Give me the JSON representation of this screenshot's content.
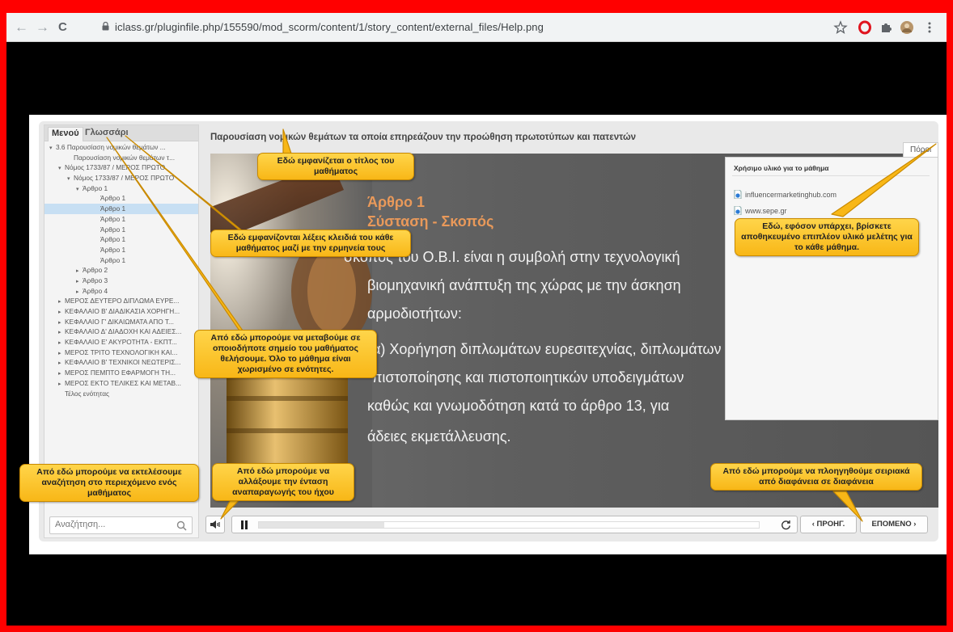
{
  "browser": {
    "url": "iclass.gr/pluginfile.php/155590/mod_scorm/content/1/story_content/external_files/Help.png",
    "back": "←",
    "forward": "→",
    "reload": "C"
  },
  "sidebar": {
    "tabs": [
      "Μενού",
      "Γλωσσάρι"
    ],
    "toc": [
      {
        "label": "3.6 Παρουσίαση νομικών θεμάτων ...",
        "indent": 0,
        "arrow": "▾"
      },
      {
        "label": "Παρουσίαση νομικών θεμάτων τ...",
        "indent": 2,
        "arrow": ""
      },
      {
        "label": "Νόμος 1733/87 / ΜΕΡΟΣ ΠΡΩΤΟ",
        "indent": 1,
        "arrow": "▾"
      },
      {
        "label": "Νόμος 1733/87 / ΜΕΡΟΣ ΠΡΩΤΟ",
        "indent": 2,
        "arrow": "▾"
      },
      {
        "label": "Άρθρο 1",
        "indent": 3,
        "arrow": "▾"
      },
      {
        "label": "Άρθρο 1",
        "indent": 5,
        "arrow": ""
      },
      {
        "label": "Άρθρο 1",
        "indent": 5,
        "arrow": "",
        "selected": true
      },
      {
        "label": "Άρθρο 1",
        "indent": 5,
        "arrow": ""
      },
      {
        "label": "Άρθρο 1",
        "indent": 5,
        "arrow": ""
      },
      {
        "label": "Άρθρο 1",
        "indent": 5,
        "arrow": ""
      },
      {
        "label": "Άρθρο 1",
        "indent": 5,
        "arrow": ""
      },
      {
        "label": "Άρθρο 1",
        "indent": 5,
        "arrow": ""
      },
      {
        "label": "Άρθρο 2",
        "indent": 3,
        "arrow": "▸"
      },
      {
        "label": "Άρθρο 3",
        "indent": 3,
        "arrow": "▸"
      },
      {
        "label": "Άρθρο 4",
        "indent": 3,
        "arrow": "▸"
      },
      {
        "label": "ΜΕΡΟΣ ΔΕΥΤΕΡΟ ΔΙΠΛΩΜΑ ΕΥΡΕ...",
        "indent": 1,
        "arrow": "▸"
      },
      {
        "label": "ΚΕΦΑΛΑΙΟ Β' ΔΙΑΔΙΚΑΣΙΑ ΧΟΡΗΓΗ...",
        "indent": 1,
        "arrow": "▸"
      },
      {
        "label": "ΚΕΦΑΛΑΙΟ Γ' ΔΙΚΑΙΩΜΑΤΑ ΑΠΟ Τ...",
        "indent": 1,
        "arrow": "▸"
      },
      {
        "label": "ΚΕΦΑΛΑΙΟ Δ' ΔΙΑΔΟΧΗ ΚΑΙ ΑΔΕΙΕΣ...",
        "indent": 1,
        "arrow": "▸"
      },
      {
        "label": "ΚΕΦΑΛΑΙΟ Ε' ΑΚΥΡΟΤΗΤΑ - ΕΚΠΤ...",
        "indent": 1,
        "arrow": "▸"
      },
      {
        "label": "ΜΕΡΟΣ ΤΡΙΤΟ ΤΕΧΝΟΛΟΓΙΚΗ ΚΑΙ...",
        "indent": 1,
        "arrow": "▸"
      },
      {
        "label": "ΚΕΦΑΛΑΙΟ Β' ΤΕΧΝΙΚΟΙ ΝΕΩΤΕΡΙΣ...",
        "indent": 1,
        "arrow": "▸"
      },
      {
        "label": "ΜΕΡΟΣ ΠΕΜΠΤΟ ΕΦΑΡΜΟΓΗ ΤΗ...",
        "indent": 1,
        "arrow": "▸"
      },
      {
        "label": "ΜΕΡΟΣ ΕΚΤΟ ΤΕΛΙΚΕΣ ΚΑΙ ΜΕΤΑΒ...",
        "indent": 1,
        "arrow": "▸"
      },
      {
        "label": "Τέλος ενότητας",
        "indent": 1,
        "arrow": ""
      }
    ],
    "search_placeholder": "Αναζήτηση..."
  },
  "main": {
    "lesson_title": "Παρουσίαση νομικών θεμάτων τα οποία επηρεάζουν την προώθηση πρωτοτύπων και πατεντών",
    "slide": {
      "heading1": "Άρθρο 1",
      "heading2": "Σύσταση - Σκοπός",
      "lines": [
        "σκοπός του Ο.Β.Ι. είναι η συμβολή στην τεχνολογική",
        "βιομηχανική ανάπτυξη της χώρας με την άσκηση",
        "αρμοδιοτήτων:",
        "α) Χορήγηση διπλωμάτων ευρεσιτεχνίας, διπλωμάτων",
        "πιστοποίησης και πιστοποιητικών υποδειγμάτων",
        "καθώς και γνωμοδότηση κατά το άρθρο 13, για",
        "άδειες εκμετάλλευσης."
      ]
    },
    "resources": {
      "tab": "Πόροι",
      "title": "Χρήσιμο υλικό για το μάθημα",
      "links": [
        "influencermarketinghub.com",
        "www.sepe.gr"
      ]
    },
    "controls": {
      "prev": "‹ ΠΡΟΗΓ.",
      "next": "ΕΠΟΜΕΝΟ ›",
      "progress": 0.25
    }
  },
  "callouts": {
    "title": "Εδώ εμφανίζεται ο τίτλος του μαθήματος",
    "glossary": "Εδώ εμφανίζονται λέξεις κλειδιά του κάθε μαθήματος μαζί με την ερμηνεία τους",
    "menu": "Από εδώ μπορούμε να μεταβούμε σε οποιοδήποτε σημείο του μαθήματος θελήσουμε. Όλο το μάθημα είναι χωρισμένο σε ενότητες.",
    "search": "Από εδώ μπορούμε να εκτελέσουμε αναζήτηση στο περιεχόμενο ενός μαθήματος",
    "volume": "Από εδώ μπορούμε να αλλάξουμε την ένταση αναπαραγωγής του ήχου",
    "resources": "Εδώ, εφόσον υπάρχει, βρίσκετε αποθηκευμένο επιπλέον υλικό μελέτης για το κάθε μάθημα.",
    "navigation": "Από εδώ μπορούμε να πλοηγηθούμε σειριακά από διαφάνεια σε διαφάνεια"
  },
  "colors": {
    "frame": "#ff0000",
    "callout": "#f8b717",
    "slide_heading": "#e9995a",
    "toc_selected": "#c7dff3"
  }
}
